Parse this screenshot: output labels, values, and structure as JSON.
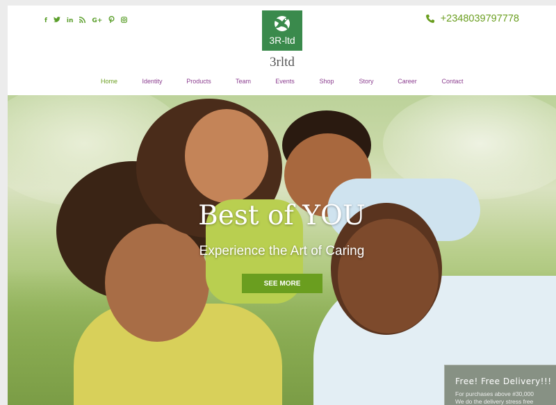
{
  "header": {
    "social_icons": [
      "facebook-icon",
      "twitter-icon",
      "linkedin-icon",
      "rss-icon",
      "google-plus-icon",
      "pinterest-icon",
      "instagram-icon"
    ],
    "social_glyphs": [
      "f",
      "t",
      "in",
      "ⓡ",
      "G+",
      "p",
      "▣"
    ],
    "logo_text": "3R-ltd",
    "brand_name": "3rltd",
    "phone": "+2348039797778"
  },
  "nav": {
    "items": [
      "Home",
      "Identity",
      "Products",
      "Team",
      "Events",
      "Shop",
      "Story",
      "Career",
      "Contact"
    ],
    "active": "Home"
  },
  "hero": {
    "title": "Best of YOU",
    "subtitle": "Experience the Art of Caring",
    "button_label": "SEE MORE"
  },
  "promo": {
    "title": "Free! Free Delivery!!!",
    "line1": "For purchases above #30,000",
    "line2": "We do the delivery stress free"
  },
  "colors": {
    "accent": "#6a9e1f",
    "nav_link": "#8b3d8f",
    "logo_bg": "#3a8a4c"
  }
}
